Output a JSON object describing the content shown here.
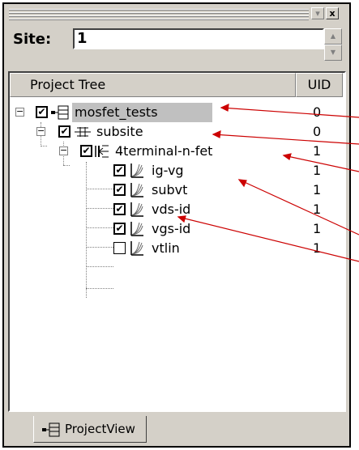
{
  "titlebar": {
    "minimize_glyph": "▾",
    "close_glyph": "x"
  },
  "site": {
    "label": "Site:",
    "value": "1"
  },
  "tree": {
    "headers": {
      "tree": "Project Tree",
      "uid": "UID"
    },
    "rows": [
      {
        "label": "mosfet_tests",
        "uid": "0",
        "checked": true,
        "icon": "project-icon",
        "selected": true
      },
      {
        "label": "subsite",
        "uid": "0",
        "checked": true,
        "icon": "subsite-icon"
      },
      {
        "label": "4terminal-n-fet",
        "uid": "1",
        "checked": true,
        "icon": "device-icon"
      },
      {
        "label": "ig-vg",
        "uid": "1",
        "checked": true,
        "icon": "test-curve-icon"
      },
      {
        "label": "subvt",
        "uid": "1",
        "checked": true,
        "icon": "test-curve-icon"
      },
      {
        "label": "vds-id",
        "uid": "1",
        "checked": true,
        "icon": "test-curve-icon"
      },
      {
        "label": "vgs-id",
        "uid": "1",
        "checked": true,
        "icon": "test-curve-icon"
      },
      {
        "label": "vtlin",
        "uid": "1",
        "checked": false,
        "icon": "test-curve-icon"
      }
    ],
    "expander_glyph": "−",
    "check_glyph": "✔"
  },
  "tab": {
    "label": "ProjectView",
    "icon": "project-tree-icon"
  },
  "colors": {
    "panel": "#d4d0c8",
    "selection": "#c0c0c0",
    "arrow": "#cc0000"
  }
}
